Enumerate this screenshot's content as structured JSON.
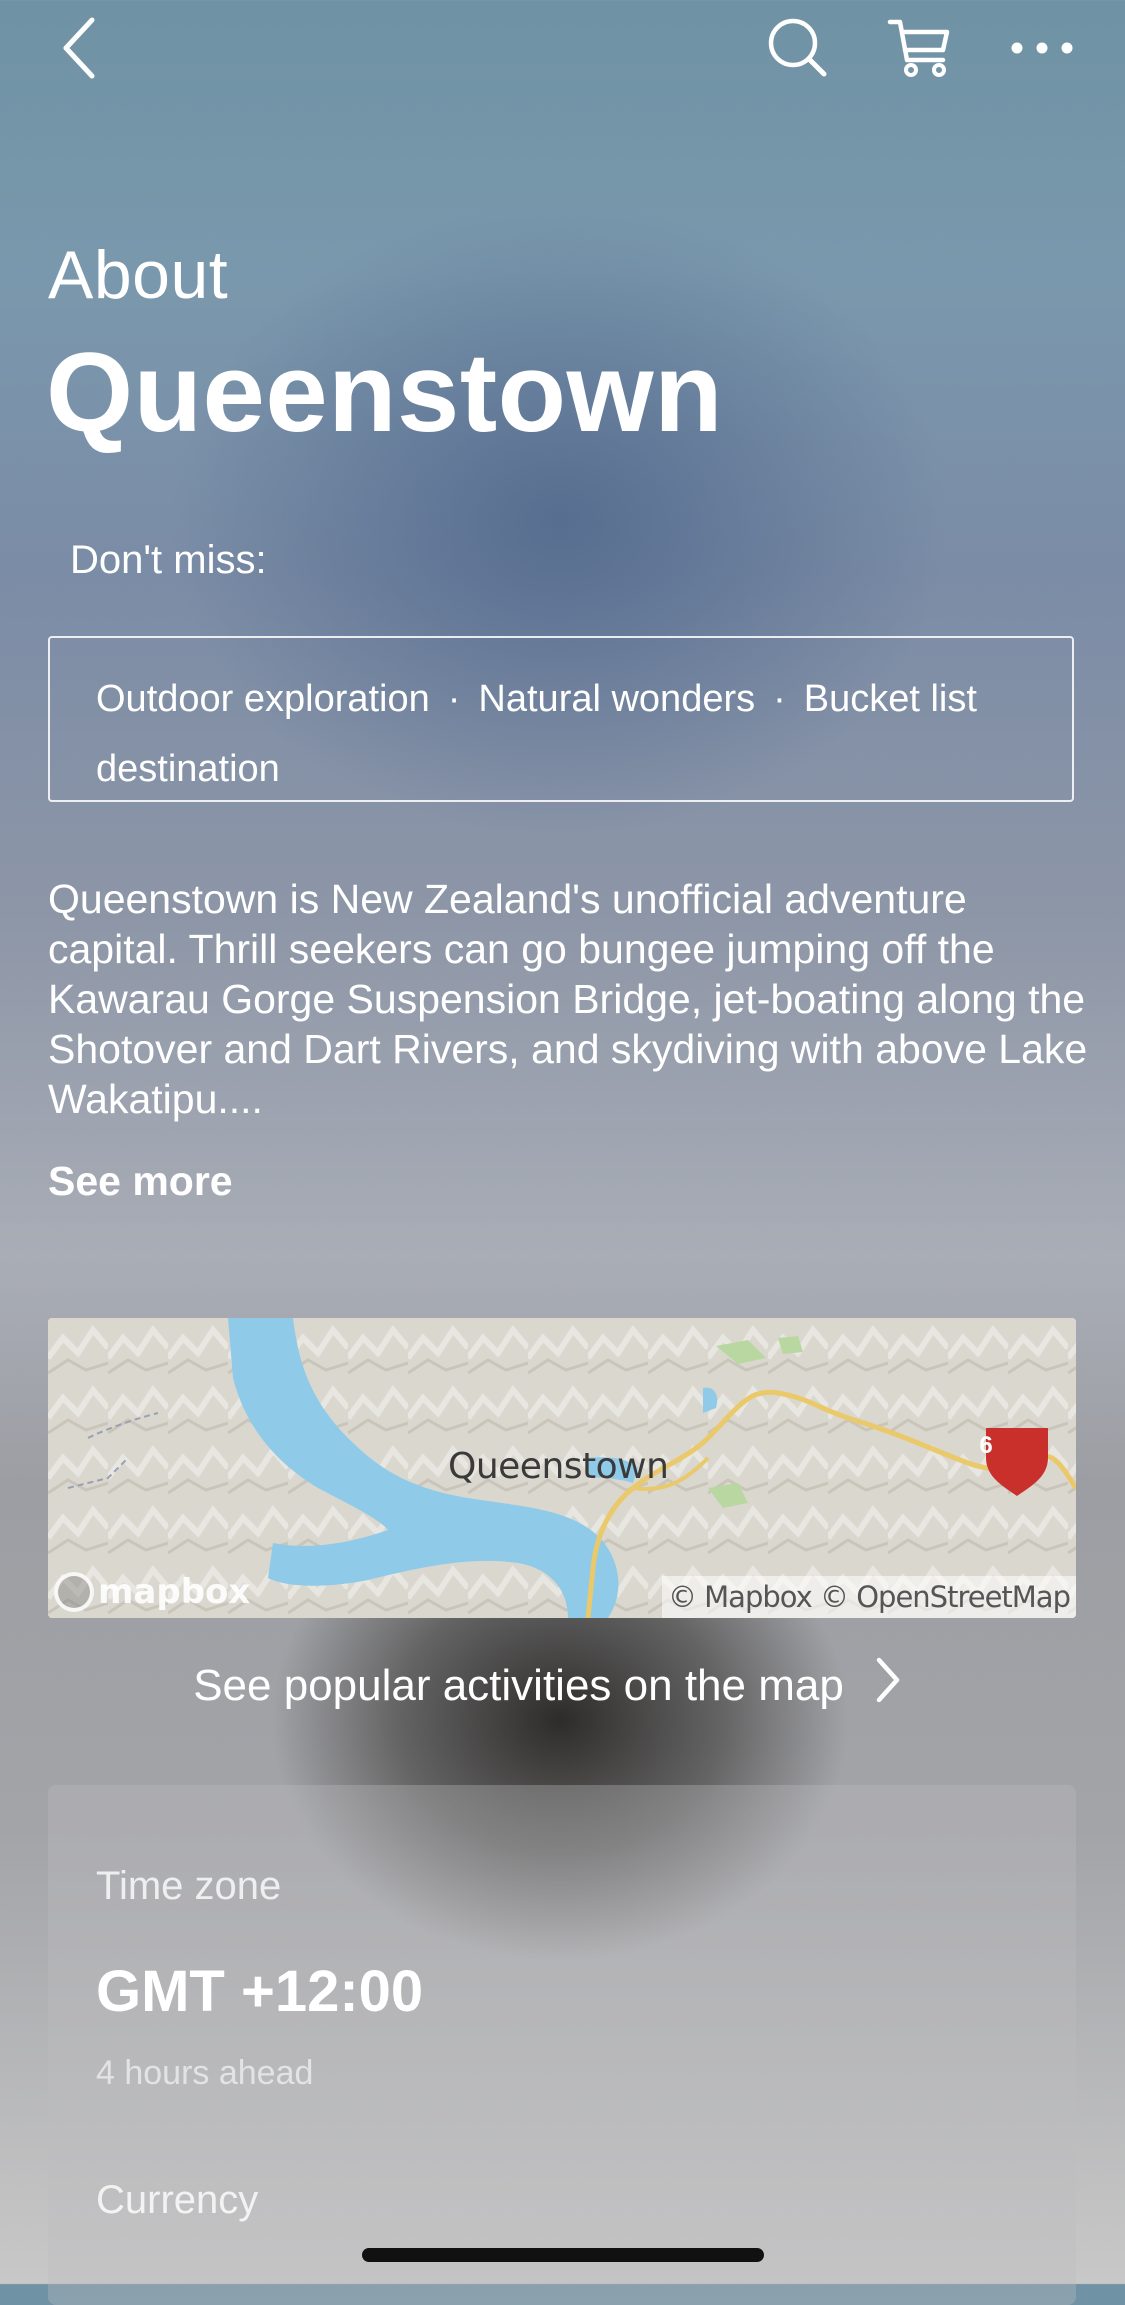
{
  "nav": {
    "back_icon": "chevron-left-icon",
    "search_icon": "search-icon",
    "cart_icon": "cart-icon",
    "more_icon": "more-horizontal-icon"
  },
  "header": {
    "about_label": "About",
    "city": "Queenstown"
  },
  "dont_miss": {
    "label": "Don't miss:",
    "tags": [
      "Outdoor exploration",
      "Natural wonders",
      "Bucket list destination"
    ]
  },
  "description": {
    "text": "Queenstown is New Zealand's unofficial adventure capital. Thrill seekers can go bungee jumping off the Kawarau Gorge Suspension Bridge, jet-boating along the Shotover and Dart Rivers, and skydiving with above Lake Wakatipu....",
    "see_more_label": "See more"
  },
  "map": {
    "place_label": "Queenstown",
    "logo_text": "mapbox",
    "attribution": "© Mapbox © OpenStreetMap",
    "route_badge": "6",
    "link_label": "See popular activities on the map"
  },
  "info": {
    "time_zone_label": "Time zone",
    "time_zone_value": "GMT +12:00",
    "time_zone_sub": "4 hours ahead",
    "currency_label": "Currency"
  },
  "colors": {
    "lake": "#8fcbe9",
    "road": "#e9c96a",
    "badge": "#c9302c"
  }
}
